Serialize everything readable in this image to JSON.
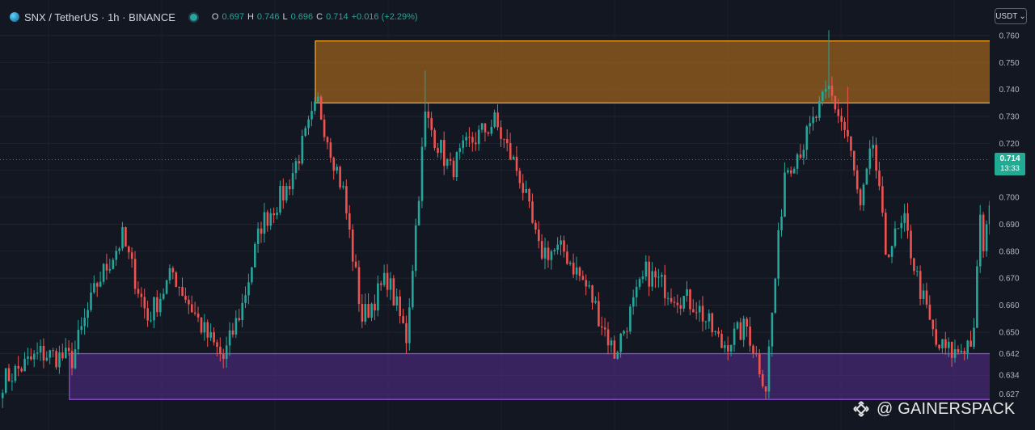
{
  "header": {
    "symbol": "SNX / TetherUS · 1h · BINANCE",
    "o_label": "O",
    "o_value": "0.697",
    "h_label": "H",
    "h_value": "0.746",
    "l_label": "L",
    "l_value": "0.696",
    "c_label": "C",
    "c_value": "0.714",
    "change": "+0.016 (+2.29%)"
  },
  "currency_button": {
    "label": "USDT",
    "caret": "⌄"
  },
  "last_price": {
    "value": "0.714",
    "countdown": "13:33"
  },
  "watermark": {
    "text": "@ GAINERSPACK",
    "icon": "binance-logo-icon"
  },
  "colors": {
    "background": "#131722",
    "up": "#26a69a",
    "down": "#ef5350",
    "resistance_zone": "#b5701c",
    "resistance_border": "#f0a52c",
    "support_zone": "#5a2d8f",
    "support_border": "#8a4fd0"
  },
  "chart_data": {
    "type": "candlestick",
    "symbol": "SNX/USDT",
    "timeframe": "1h",
    "y_ticks": [
      "0.760",
      "0.750",
      "0.740",
      "0.730",
      "0.720",
      "0.710",
      "0.700",
      "0.690",
      "0.680",
      "0.670",
      "0.660",
      "0.650",
      "0.642",
      "0.634",
      "0.627"
    ],
    "ylim": [
      0.625,
      0.762
    ],
    "zones": [
      {
        "name": "resistance",
        "from": 0.735,
        "to": 0.758,
        "x_start": 100,
        "x_end": 318
      },
      {
        "name": "support",
        "from": 0.625,
        "to": 0.642,
        "x_start": 22,
        "x_end": 330
      }
    ],
    "anchors": [
      [
        0,
        0.632
      ],
      [
        12,
        0.642
      ],
      [
        22,
        0.64
      ],
      [
        30,
        0.668
      ],
      [
        38,
        0.685
      ],
      [
        46,
        0.655
      ],
      [
        54,
        0.672
      ],
      [
        64,
        0.65
      ],
      [
        70,
        0.64
      ],
      [
        76,
        0.66
      ],
      [
        82,
        0.69
      ],
      [
        90,
        0.703
      ],
      [
        100,
        0.735
      ],
      [
        108,
        0.702
      ],
      [
        114,
        0.655
      ],
      [
        122,
        0.67
      ],
      [
        128,
        0.648
      ],
      [
        134,
        0.73
      ],
      [
        142,
        0.71
      ],
      [
        148,
        0.72
      ],
      [
        156,
        0.728
      ],
      [
        164,
        0.708
      ],
      [
        170,
        0.68
      ],
      [
        178,
        0.68
      ],
      [
        186,
        0.665
      ],
      [
        194,
        0.642
      ],
      [
        204,
        0.672
      ],
      [
        212,
        0.665
      ],
      [
        220,
        0.66
      ],
      [
        228,
        0.645
      ],
      [
        236,
        0.652
      ],
      [
        242,
        0.63
      ],
      [
        248,
        0.71
      ],
      [
        254,
        0.72
      ],
      [
        262,
        0.74
      ],
      [
        268,
        0.722
      ],
      [
        272,
        0.695
      ],
      [
        276,
        0.72
      ],
      [
        280,
        0.68
      ],
      [
        286,
        0.69
      ],
      [
        290,
        0.67
      ],
      [
        296,
        0.645
      ],
      [
        302,
        0.642
      ],
      [
        308,
        0.648
      ],
      [
        310,
        0.695
      ],
      [
        314,
        0.714
      ]
    ],
    "last_candle": {
      "open": 0.697,
      "high": 0.746,
      "low": 0.696,
      "close": 0.714
    }
  }
}
